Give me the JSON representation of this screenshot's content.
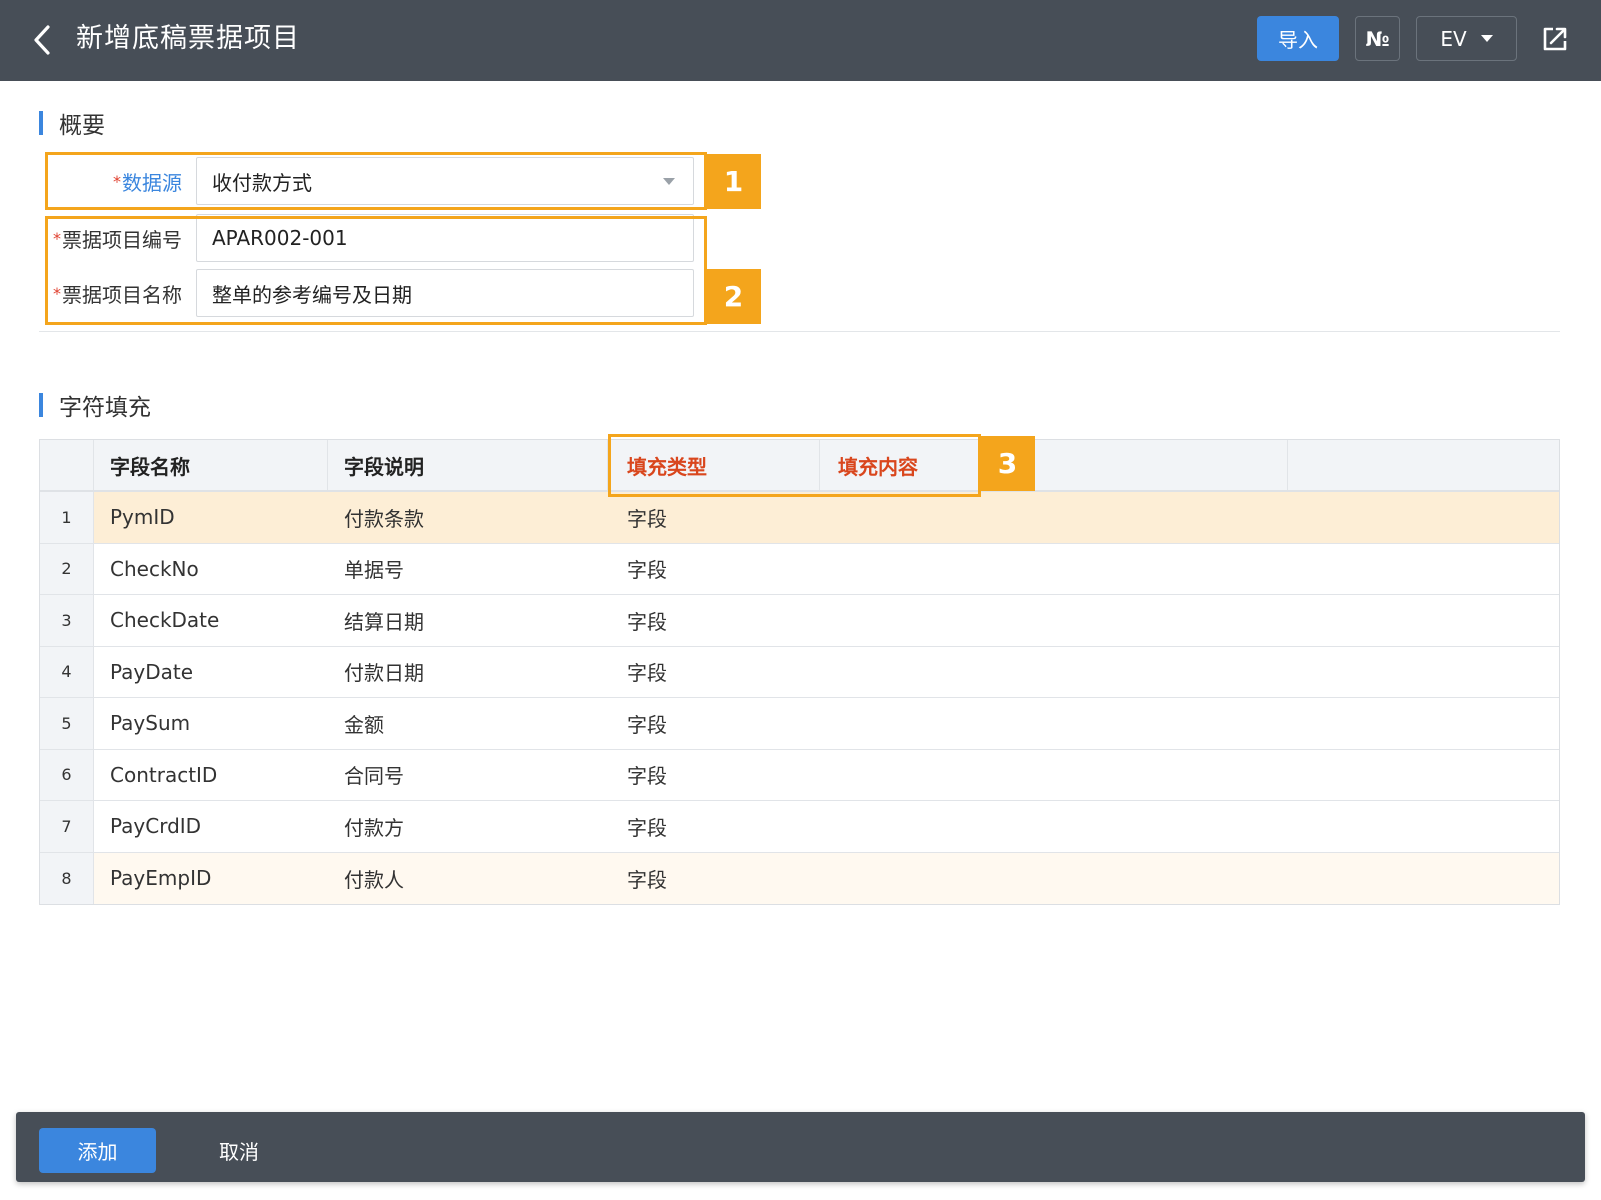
{
  "header": {
    "title": "新增底稿票据项目",
    "import_label": "导入",
    "number_label": "№",
    "env_label": "EV",
    "icons": {
      "back": "chevron-left-icon",
      "share": "external-link-icon",
      "env_dropdown": "caret-down-icon"
    }
  },
  "overview": {
    "title": "概要",
    "data_source": {
      "required_mark": "*",
      "label": "数据源",
      "value": "收付款方式"
    },
    "item_code": {
      "required_mark": "*",
      "label": "票据项目编号",
      "value": "APAR002-001"
    },
    "item_name": {
      "required_mark": "*",
      "label": "票据项目名称",
      "value": "整单的参考编号及日期"
    }
  },
  "annotations": {
    "n1": "1",
    "n2": "2",
    "n3": "3"
  },
  "fill": {
    "title": "字符填充",
    "columns": [
      "字段名称",
      "字段说明",
      "填充类型",
      "填充内容",
      ""
    ],
    "rows": [
      {
        "idx": "1",
        "field": "PymID",
        "desc": "付款条款",
        "type": "字段",
        "content": ""
      },
      {
        "idx": "2",
        "field": "CheckNo",
        "desc": "单据号",
        "type": "字段",
        "content": ""
      },
      {
        "idx": "3",
        "field": "CheckDate",
        "desc": "结算日期",
        "type": "字段",
        "content": ""
      },
      {
        "idx": "4",
        "field": "PayDate",
        "desc": "付款日期",
        "type": "字段",
        "content": ""
      },
      {
        "idx": "5",
        "field": "PaySum",
        "desc": "金额",
        "type": "字段",
        "content": ""
      },
      {
        "idx": "6",
        "field": "ContractID",
        "desc": "合同号",
        "type": "字段",
        "content": ""
      },
      {
        "idx": "7",
        "field": "PayCrdID",
        "desc": "付款方",
        "type": "字段",
        "content": ""
      },
      {
        "idx": "8",
        "field": "PayEmpID",
        "desc": "付款人",
        "type": "字段",
        "content": ""
      }
    ]
  },
  "footer": {
    "add_label": "添加",
    "cancel_label": "取消"
  },
  "colors": {
    "header_bg": "#474e57",
    "accent": "#3b86de",
    "highlight": "#f4a51c",
    "selected_row": "#fdeed6",
    "header_red": "#d9461d"
  }
}
